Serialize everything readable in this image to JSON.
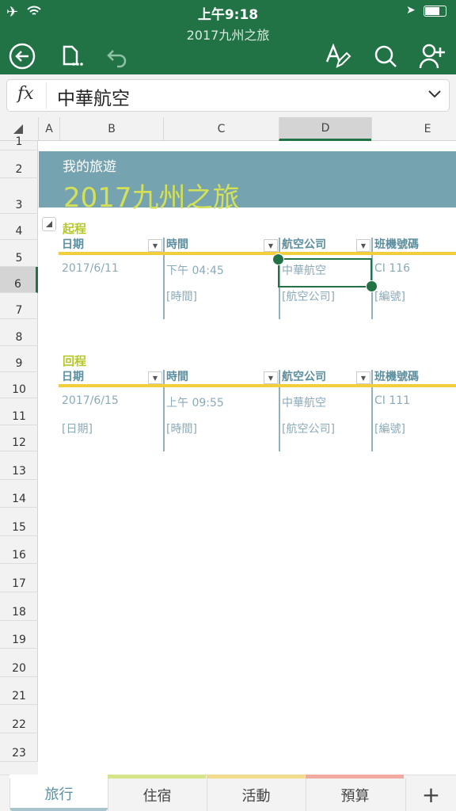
{
  "status": {
    "time": "上午9:18",
    "airplane_icon": "airplane-icon",
    "wifi_icon": "wifi-icon",
    "location_icon": "location-arrow-icon",
    "battery_icon": "battery-icon"
  },
  "doc_title": "2017九州之旅",
  "toolbar": {
    "icons": [
      "back-icon",
      "file-menu-icon",
      "undo-icon",
      "draw-icon",
      "search-icon",
      "share-person-icon"
    ]
  },
  "formula": {
    "fx": "fx",
    "value": "中華航空"
  },
  "columns": [
    "A",
    "B",
    "C",
    "D",
    "E"
  ],
  "selected_column": "D",
  "selected_row": "6",
  "rows": [
    "1",
    "2",
    "3",
    "4",
    "5",
    "6",
    "7",
    "8",
    "9",
    "10",
    "11",
    "12",
    "13",
    "14",
    "15",
    "16",
    "17",
    "18",
    "19",
    "20",
    "21",
    "22",
    "23"
  ],
  "sheet": {
    "subtitle": "我的旅遊",
    "title": "2017九州之旅",
    "outbound": {
      "label": "起程",
      "headers": [
        "日期",
        "時間",
        "航空公司",
        "班機號碼"
      ],
      "row1": [
        "2017/6/11",
        "下午 04:45",
        "中華航空",
        "CI 116"
      ],
      "row2": [
        "",
        "[時間]",
        "[航空公司]",
        "[編號]"
      ]
    },
    "return": {
      "label": "回程",
      "headers": [
        "日期",
        "時間",
        "航空公司",
        "班機號碼"
      ],
      "row1": [
        "2017/6/15",
        "上午 09:55",
        "中華航空",
        "CI 111"
      ],
      "row2": [
        "[日期]",
        "[時間]",
        "[航空公司]",
        "[編號]"
      ]
    }
  },
  "tabs": [
    {
      "label": "旅行",
      "color": "#a9c4cc"
    },
    {
      "label": "住宿",
      "color": "#d6e58a"
    },
    {
      "label": "活動",
      "color": "#f0dc8a"
    },
    {
      "label": "預算",
      "color": "#f0aaa0"
    }
  ],
  "add_tab": "+",
  "colors": {
    "accent": "#217346",
    "banner": "#76a3b0",
    "title": "#d4e157",
    "rule": "#f2ce3d"
  }
}
